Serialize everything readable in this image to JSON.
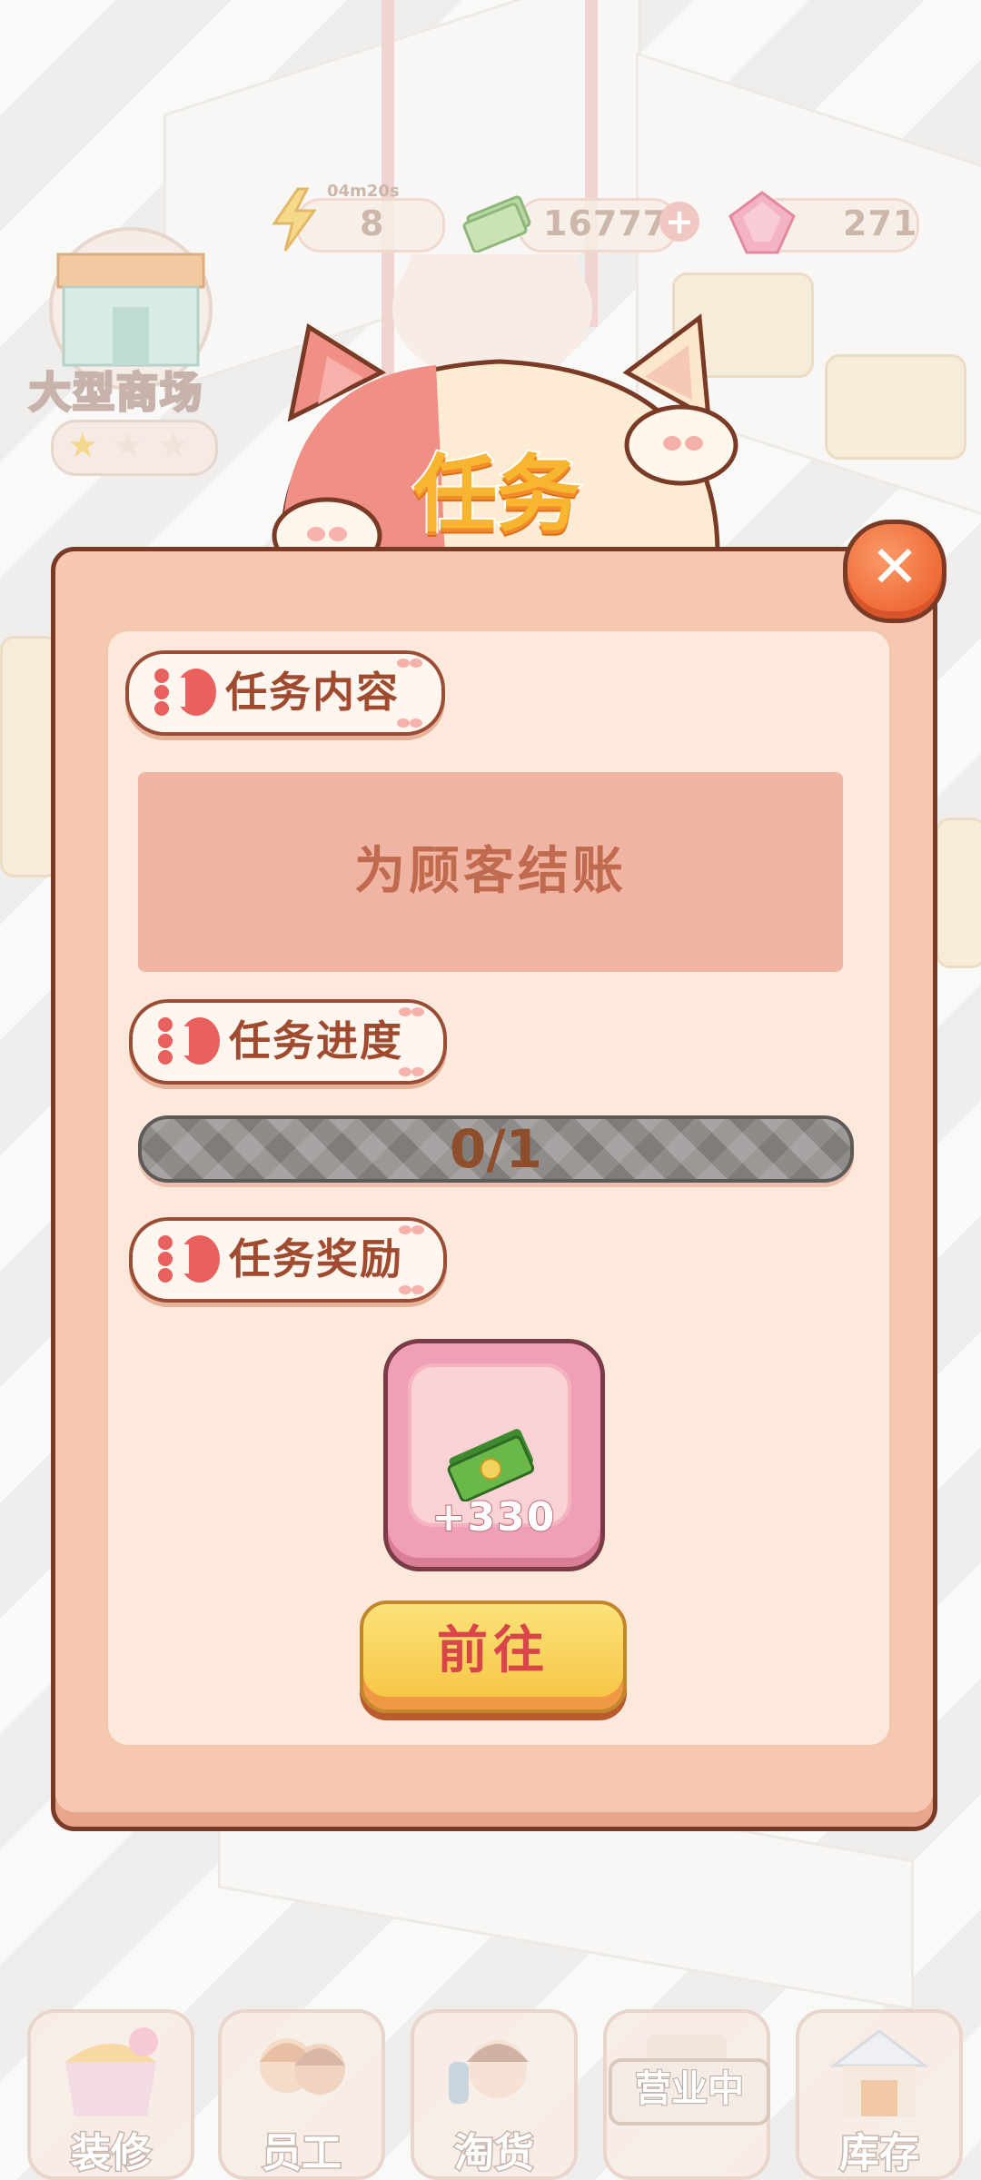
{
  "hud": {
    "timer": "04m20s",
    "energy": "8",
    "money": "16777",
    "gems": "271",
    "store_name": "大型商场",
    "stars_filled": 1,
    "stars_total": 3
  },
  "dialog": {
    "title": "任务",
    "sections": {
      "content_label": "任务内容",
      "progress_label": "任务进度",
      "reward_label": "任务奖励"
    },
    "task_text": "为顾客结账",
    "progress": {
      "text": "0/1",
      "fraction": 0
    },
    "reward": {
      "icon": "cash-icon",
      "amount": "+330"
    },
    "go_button": "前往",
    "close_icon": "close-icon"
  },
  "bottom_nav": {
    "items": [
      {
        "label": "装修",
        "icon": "decorate-icon"
      },
      {
        "label": "员工",
        "icon": "staff-icon"
      },
      {
        "label": "淘货",
        "icon": "shopping-icon"
      },
      {
        "label": "",
        "icon": "cart-icon"
      },
      {
        "label": "库存",
        "icon": "storage-icon"
      }
    ],
    "status": "营业中"
  },
  "colors": {
    "panel": "#f7c8b1",
    "panel_border": "#7a3b26",
    "title": "#f8b52f",
    "go_button": "#f6c33f",
    "close_button": "#ee6a35"
  }
}
